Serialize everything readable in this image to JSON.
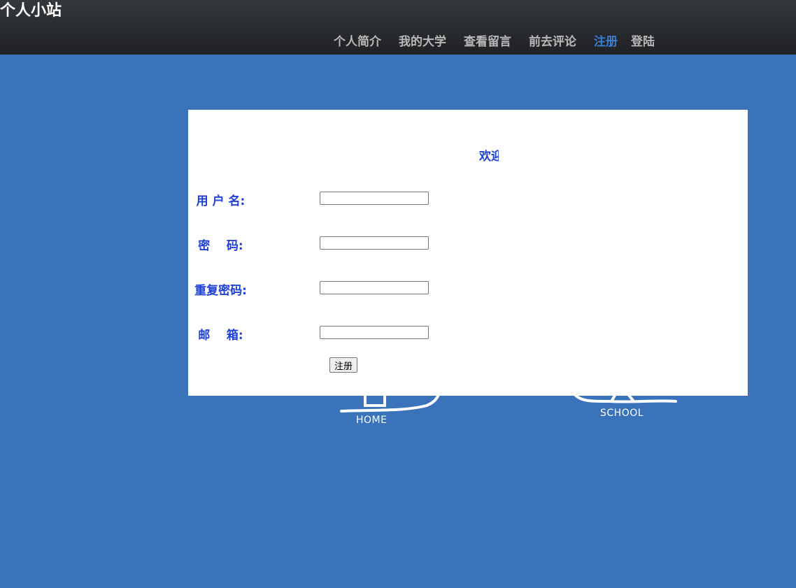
{
  "header": {
    "site_title": "个人小站",
    "nav": [
      {
        "label": "个人简介"
      },
      {
        "label": "我的大学"
      },
      {
        "label": "查看留言"
      },
      {
        "label": "前去评论"
      },
      {
        "label": "注册",
        "active": true
      },
      {
        "label": "登陆"
      }
    ]
  },
  "form": {
    "welcome": "欢迎",
    "fields": [
      {
        "label": "用 户 名:",
        "value": ""
      },
      {
        "label": "密    码:",
        "value": ""
      },
      {
        "label": "重复密码:",
        "value": ""
      },
      {
        "label": "邮    箱:",
        "value": ""
      }
    ],
    "submit_label": "注册"
  },
  "background": {
    "home_label": "HOME",
    "school_label": "SCHOOL"
  },
  "colors": {
    "background": "#3a73b9",
    "label": "#1e3fd6",
    "nav_active": "#3a7fd5",
    "nav": "#b8b8b8"
  }
}
